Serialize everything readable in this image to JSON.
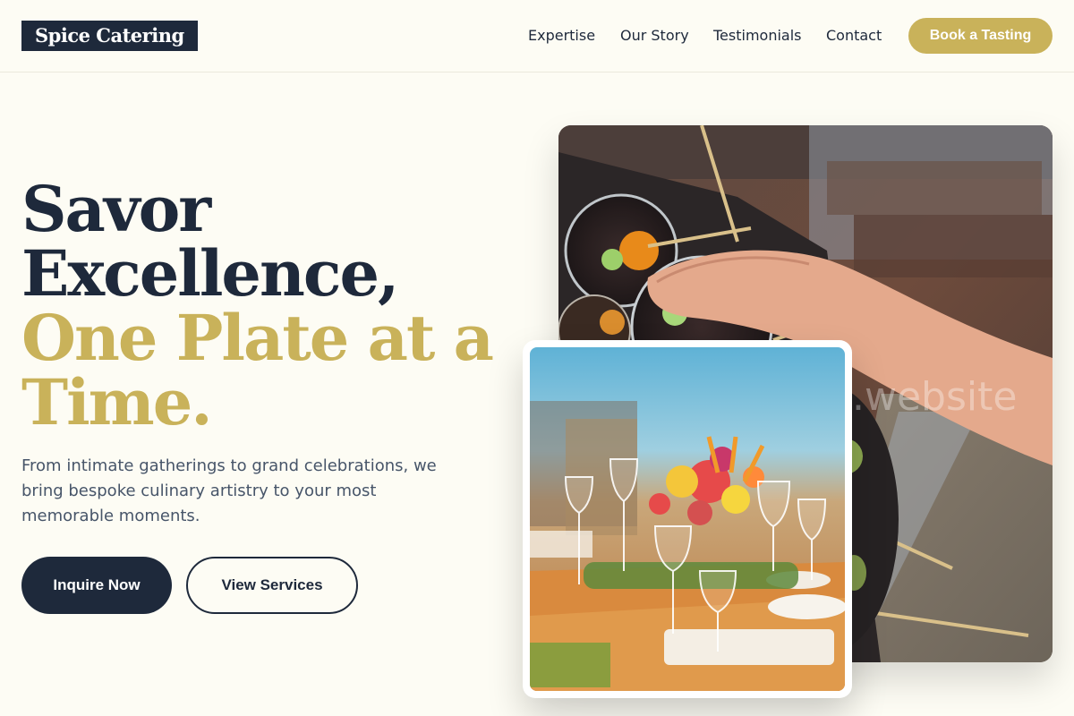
{
  "brand": {
    "logo_text": "Spice Catering"
  },
  "nav": {
    "items": [
      "Expertise",
      "Our Story",
      "Testimonials",
      "Contact"
    ],
    "cta_label": "Book a Tasting"
  },
  "hero": {
    "title_line1": "Savor",
    "title_line2": "Excellence,",
    "title_line3": "One Plate at a",
    "title_line4": "Time.",
    "subtitle": "From intimate gatherings to grand celebrations, we bring bespoke culinary artistry to your most memorable moments.",
    "primary_button": "Inquire Now",
    "secondary_button": "View Services"
  },
  "images": {
    "main_watermark": ".website"
  },
  "colors": {
    "navy": "#1e293b",
    "gold": "#c9b25a",
    "background": "#fdfcf4"
  }
}
